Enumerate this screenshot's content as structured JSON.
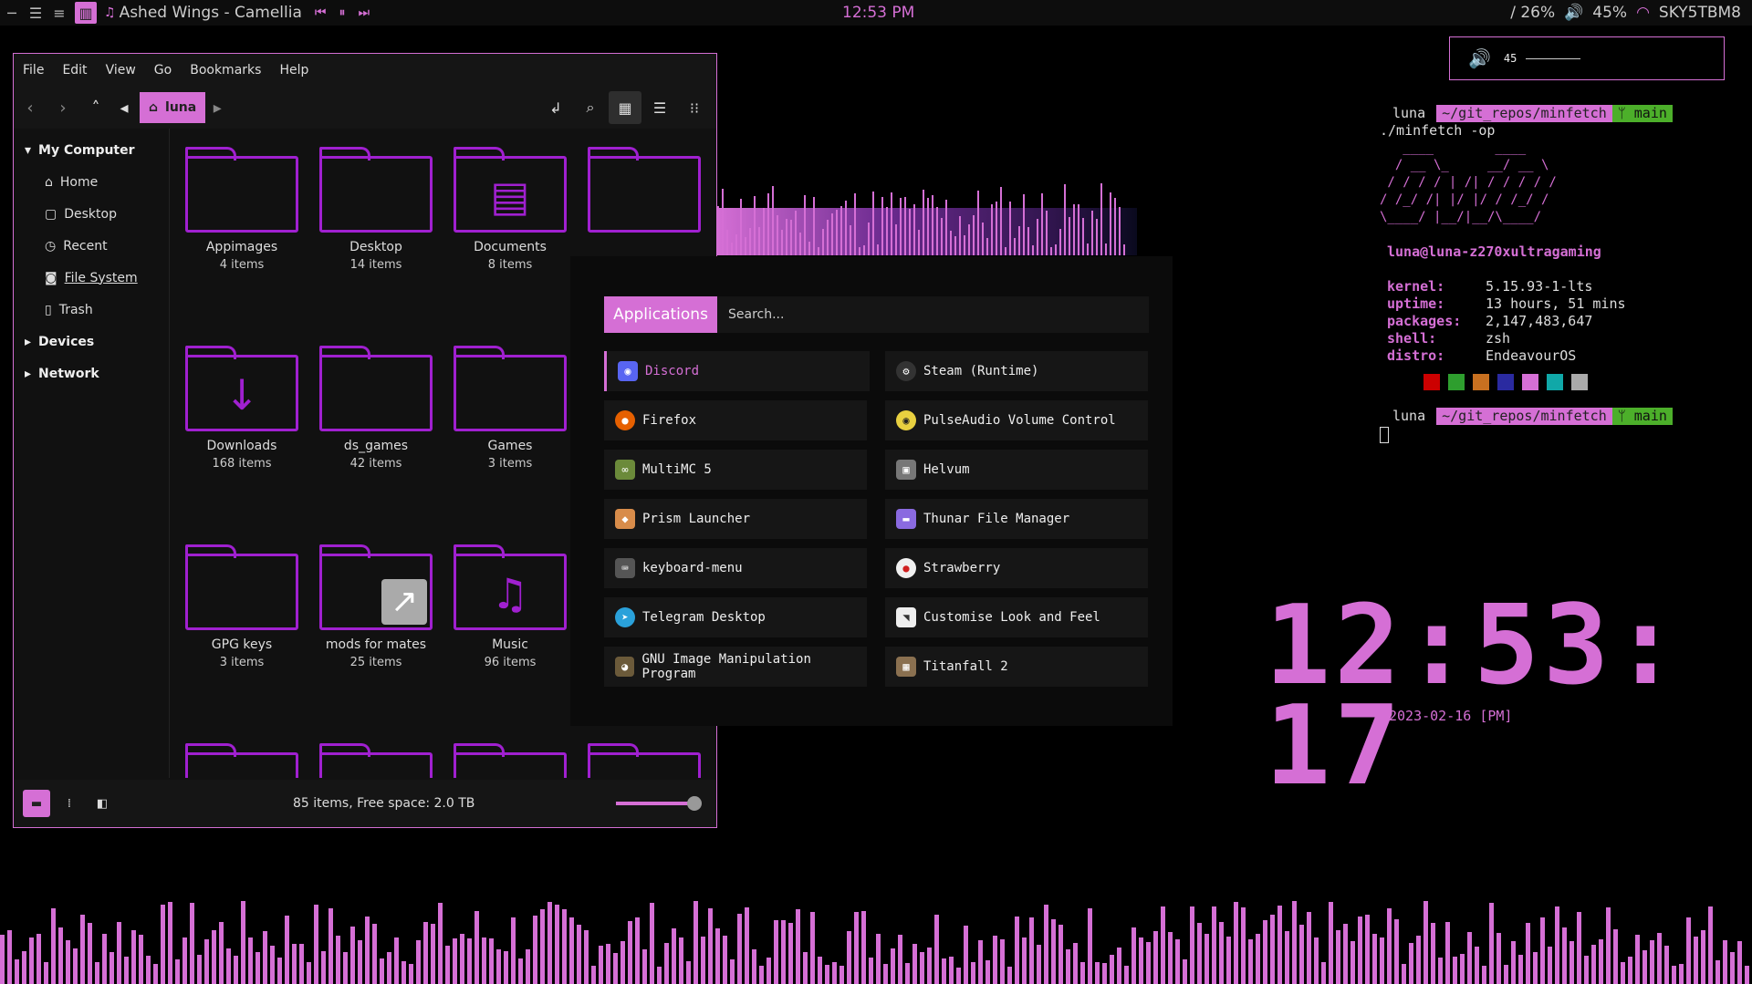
{
  "topbar": {
    "media_title": "Ashed Wings - Camellia",
    "clock": "12:53 PM",
    "battery": "/ 26%",
    "volume": "45%",
    "network": "SKY5TBM8"
  },
  "file_manager": {
    "menus": [
      "File",
      "Edit",
      "View",
      "Go",
      "Bookmarks",
      "Help"
    ],
    "location": "luna",
    "sidebar": {
      "my_computer": "My Computer",
      "items": [
        "Home",
        "Desktop",
        "Recent",
        "File System",
        "Trash"
      ],
      "devices": "Devices",
      "network": "Network"
    },
    "folders": [
      {
        "name": "Appimages",
        "count": "4 items",
        "emblem": ""
      },
      {
        "name": "Desktop",
        "count": "14 items",
        "emblem": ""
      },
      {
        "name": "Documents",
        "count": "8 items",
        "emblem": "▤"
      },
      {
        "name": "",
        "count": "",
        "emblem": ""
      },
      {
        "name": "Downloads",
        "count": "168 items",
        "emblem": "↓"
      },
      {
        "name": "ds_games",
        "count": "42 items",
        "emblem": ""
      },
      {
        "name": "Games",
        "count": "3 items",
        "emblem": ""
      },
      {
        "name": "GPG keys",
        "count": "3 items",
        "emblem": ""
      },
      {
        "name": "mods for mates",
        "count": "25 items",
        "emblem": "↗"
      },
      {
        "name": "Music",
        "count": "96 items",
        "emblem": "♫"
      }
    ],
    "status": "85 items, Free space: 2.0 TB"
  },
  "launcher": {
    "tab": "Applications",
    "search_placeholder": "Search...",
    "apps_left": [
      "Discord",
      "Firefox",
      "MultiMC 5",
      "Prism Launcher",
      "keyboard-menu",
      "Telegram Desktop",
      "GNU Image Manipulation Program"
    ],
    "apps_right": [
      "Steam (Runtime)",
      "PulseAudio Volume Control",
      "Helvum",
      "Thunar File Manager",
      "Strawberry",
      "Customise Look and Feel",
      "Titanfall 2"
    ]
  },
  "osd": {
    "volume": "45"
  },
  "terminal": {
    "user": "luna",
    "path": "~/git_repos/minfetch",
    "branch": "main",
    "command": "./minfetch -op",
    "ascii": "   ____        ____\n  / __ \\_     __/ __ \\\n / / / / | /| / / / / /\n/ /_/ /| |/ |/ / /_/ /\n\\____/ |__/|__/\\____/",
    "hostline": "luna@luna-z270xultragaming",
    "info": [
      {
        "k": "kernel:",
        "v": "5.15.93-1-lts"
      },
      {
        "k": "uptime:",
        "v": "13 hours, 51 mins"
      },
      {
        "k": "packages:",
        "v": "2,147,483,647"
      },
      {
        "k": "shell:",
        "v": "zsh"
      },
      {
        "k": "distro:",
        "v": "EndeavourOS"
      }
    ],
    "colors": [
      "#cc0000",
      "#2e9e2e",
      "#c87020",
      "#2a2aa0",
      "#d56fd5",
      "#10a8a8",
      "#aaaaaa"
    ]
  },
  "desktop_clock": {
    "time": "12:53: 17",
    "date": "2023-02-16 [PM]"
  }
}
